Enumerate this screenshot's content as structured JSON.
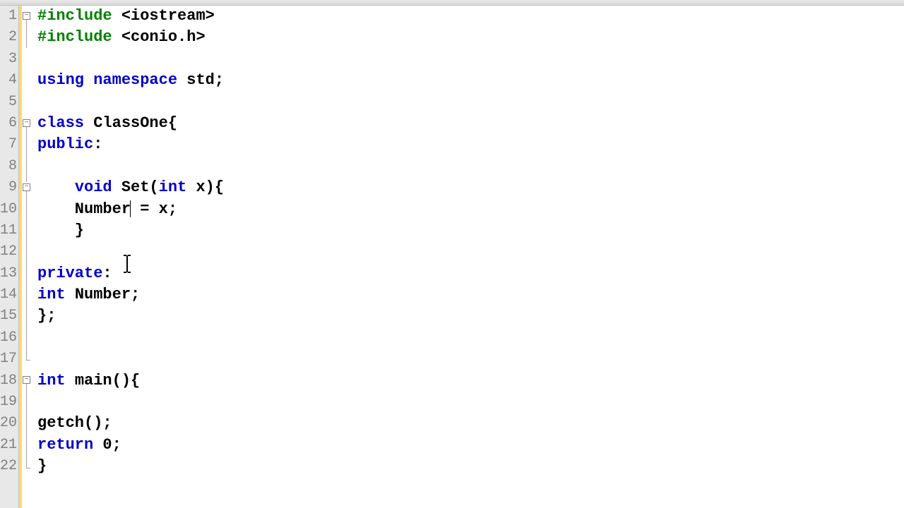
{
  "gutter": [
    "1",
    "2",
    "3",
    "4",
    "5",
    "6",
    "7",
    "8",
    "9",
    "10",
    "11",
    "12",
    "13",
    "14",
    "15",
    "16",
    "17",
    "18",
    "19",
    "20",
    "21",
    "22"
  ],
  "code": {
    "l1": {
      "a": "#include ",
      "b": "<iostream>"
    },
    "l2": {
      "a": "#include ",
      "b": "<conio.h>"
    },
    "l3": "",
    "l4": {
      "a": "using ",
      "b": "namespace ",
      "c": "std;"
    },
    "l5": "",
    "l6": {
      "a": "class ",
      "b": "ClassOne{"
    },
    "l7": {
      "a": "public",
      "b": ":"
    },
    "l8": "",
    "l9": {
      "a": "    ",
      "b": "void ",
      "c": "Set(",
      "d": "int ",
      "e": "x){"
    },
    "l10": {
      "a": "    Number",
      "b": " = x;"
    },
    "l11": {
      "a": "    }"
    },
    "l12": "",
    "l13": {
      "a": "private",
      "b": ":"
    },
    "l14": {
      "a": "int ",
      "b": "Number;"
    },
    "l15": "};",
    "l16": "",
    "l17": "",
    "l18": {
      "a": "int ",
      "b": "main(){"
    },
    "l19": "",
    "l20": "getch();",
    "l21": {
      "a": "return ",
      "b": "0;"
    },
    "l22": "}"
  },
  "fold_minus": "−"
}
